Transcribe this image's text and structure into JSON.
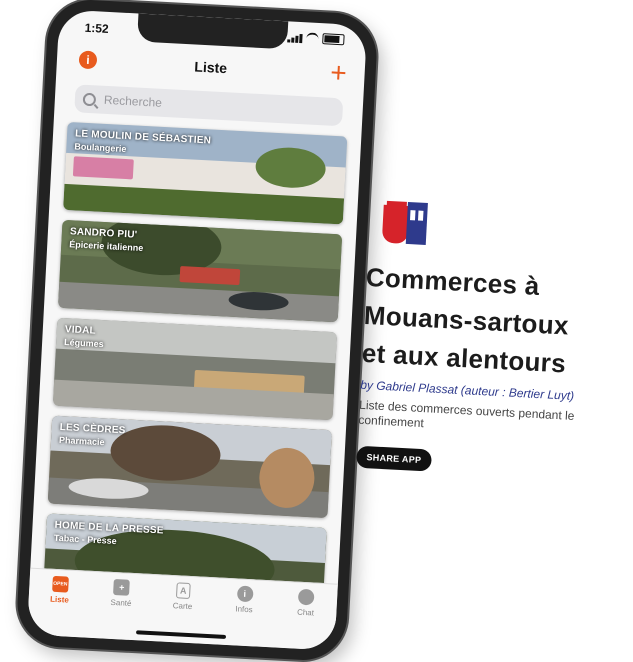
{
  "status_bar": {
    "time": "1:52"
  },
  "nav": {
    "title": "Liste",
    "info_glyph": "i",
    "add_glyph": "+"
  },
  "search": {
    "placeholder": "Recherche"
  },
  "cards": [
    {
      "title": "LE MOULIN DE SÉBASTIEN",
      "subtitle": "Boulangerie"
    },
    {
      "title": "SANDRO PIU'",
      "subtitle": "Épicerie italienne"
    },
    {
      "title": "VIDAL",
      "subtitle": "Légumes"
    },
    {
      "title": "LES CÈDRES",
      "subtitle": "Pharmacie"
    },
    {
      "title": "HOME DE LA PRESSE",
      "subtitle": "Tabac - Presse"
    }
  ],
  "tabs": [
    {
      "label": "Liste",
      "icon": "list-icon",
      "glyph": "OPEN",
      "active": true
    },
    {
      "label": "Santé",
      "icon": "health-cross-icon",
      "glyph": "+"
    },
    {
      "label": "Carte",
      "icon": "map-icon",
      "glyph": "A"
    },
    {
      "label": "Infos",
      "icon": "info-icon",
      "glyph": "i"
    },
    {
      "label": "Chat",
      "icon": "chat-bubble-icon",
      "glyph": ""
    }
  ],
  "promo": {
    "title_line1": "Commerces à",
    "title_line2": "Mouans-sartoux",
    "title_line3": "et aux alentours",
    "author": "by Gabriel Plassat (auteur : Bertier Luyt)",
    "description": "Liste des commerces ouverts pendant le confinement",
    "share_label": "SHARE APP"
  },
  "colors": {
    "accent": "#e85b1e",
    "logo_red": "#d6232a",
    "logo_blue": "#2e3a8c"
  }
}
